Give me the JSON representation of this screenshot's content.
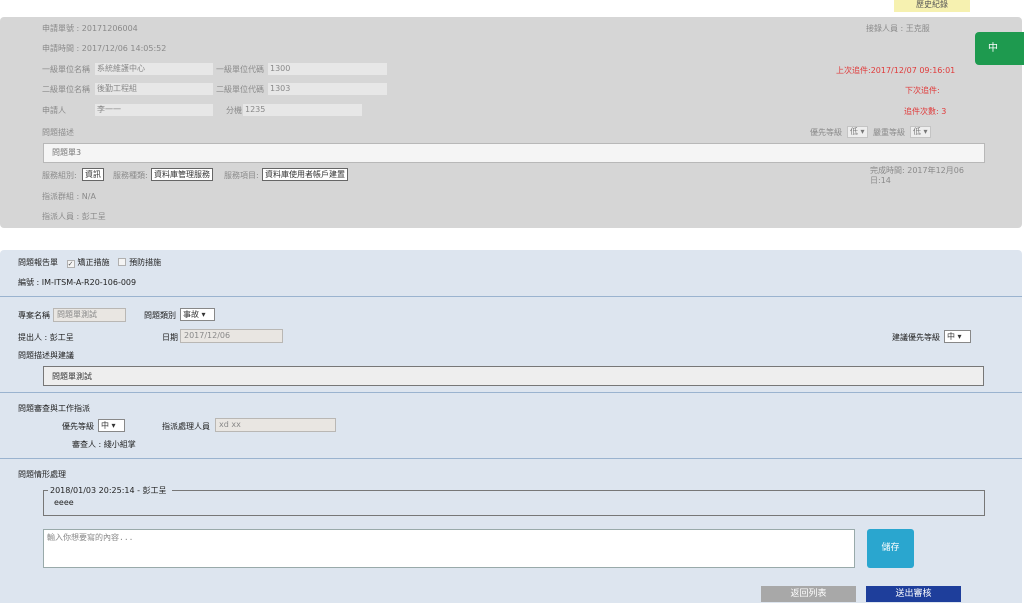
{
  "history_label": "歷史紀錄",
  "top": {
    "request_no": "申請單號 : 20171206004",
    "request_time": "申請時間 : 2017/12/06 14:05:52",
    "receiver": "接錄人員 : 王克服",
    "lvl1_unit_name_label": "一級單位名稱",
    "lvl1_unit_name_value": "系統維護中心",
    "lvl1_unit_code_label": "一級單位代碼",
    "lvl1_unit_code_value": "1300",
    "lvl2_unit_name_label": "二級單位名稱",
    "lvl2_unit_name_value": "後勤工程組",
    "lvl2_unit_code_label": "二級單位代碼",
    "lvl2_unit_code_value": "1303",
    "applicant_label": "申請人",
    "applicant_value": "李一一",
    "ext_label": "分機",
    "ext_value": "1235",
    "last_followup": "上次追件:2017/12/07 09:16:01",
    "next_followup": "下次追件:",
    "followup_count": "追件次數: 3",
    "problem_desc_label": "問題描述",
    "priority_label": "優先等級",
    "priority_value": "低 ▾",
    "severity_label": "嚴重等級",
    "severity_value": "低 ▾",
    "problem_desc_value": "問題單3",
    "service_group_label": "服務組別:",
    "service_group_value": "資訊",
    "service_type_label": "服務種類:",
    "service_type_value": "資料庫管理服務",
    "service_item_label": "服務項目:",
    "service_item_value": "資料庫使用者帳戶建置",
    "completion_time": "完成時間: 2017年12月06",
    "completion_time_2": "日:14",
    "dispatch_group": "指派群組 : N/A",
    "dispatch_person": "指派人員 : 彭工呈"
  },
  "side_button_label": "中",
  "report": {
    "report_label": "問題報告單",
    "corrective_label": "矯正措施",
    "corrective_checked": "✓",
    "preventive_label": "預防措施",
    "serial": "編號 : IM-ITSM-A-R20-106-009",
    "case_name_label": "專案名稱",
    "case_name_value": "問題單測試",
    "problem_type_label": "問題類別",
    "problem_type_value": "事故 ▾",
    "proposer": "提出人 : 彭工呈",
    "date_label": "日期",
    "date_value": "2017/12/06",
    "suggest_priority_label": "建議優先等級",
    "suggest_priority_value": "中 ▾",
    "desc_suggest_label": "問題描述與建議",
    "desc_suggest_value": "問題單測試",
    "review_section_label": "問題審查與工作指派",
    "priority_label": "優先等級",
    "priority_value": "中 ▾",
    "handler_label": "指派處理人員",
    "handler_value": "xd xx",
    "reviewer": "審查人 : 綫小組掌",
    "handling_label": "問題情形處理",
    "log_header": "2018/01/03 20:25:14 - 彭工呈",
    "log_text": "eeee",
    "comment_placeholder": "輸入你想要寫的內容...",
    "save_label": "儲存",
    "back_label": "返回列表",
    "submit_label": "送出審核"
  }
}
